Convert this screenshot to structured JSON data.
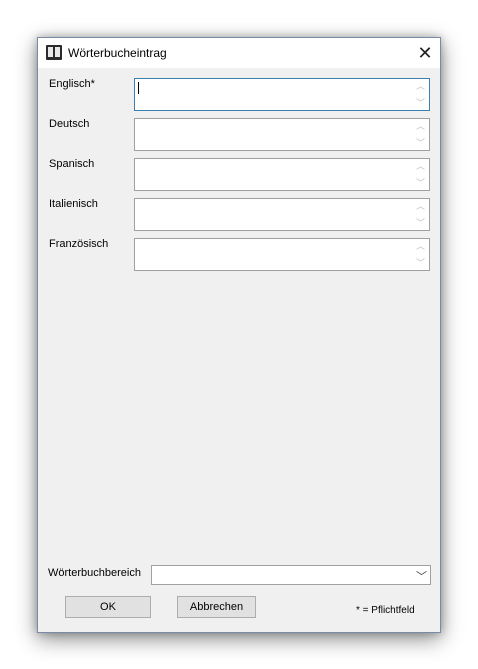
{
  "window": {
    "title": "Wörterbucheintrag",
    "close_glyph": "✕"
  },
  "fields": [
    {
      "label": "Englisch*",
      "value": ""
    },
    {
      "label": "Deutsch",
      "value": ""
    },
    {
      "label": "Spanisch",
      "value": ""
    },
    {
      "label": "Italienisch",
      "value": ""
    },
    {
      "label": "Französisch",
      "value": ""
    }
  ],
  "dictionary_area": {
    "label": "Wörterbuchbereich",
    "selected": ""
  },
  "buttons": {
    "ok": "OK",
    "cancel": "Abbrechen"
  },
  "required_note": "* = Pflichtfeld"
}
